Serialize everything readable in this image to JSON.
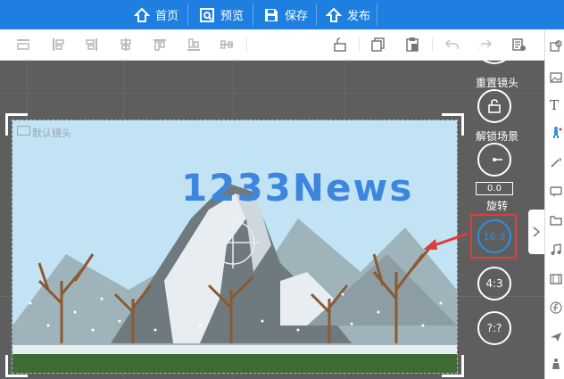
{
  "nav": {
    "home_label": "首页",
    "preview_label": "预览",
    "save_label": "保存",
    "publish_label": "发布"
  },
  "toolbar": {
    "icons": [
      "align-top-icon",
      "align-left-icon",
      "align-right-icon",
      "align-center-icon",
      "align-vcenter-icon",
      "align-bottom-icon",
      "distribute-icon",
      "unlock-icon",
      "copy-icon",
      "paste-icon",
      "undo-icon",
      "redo-icon",
      "layer-icon"
    ]
  },
  "scene": {
    "camera_label": "默认镜头",
    "title_text": "1233News"
  },
  "controls": {
    "reset_camera_label": "重置镜头",
    "unlock_scene_label": "解锁场景",
    "rotation_value": "0.0",
    "rotate_label": "旋转",
    "ratio_16_9": "16:9",
    "ratio_4_3": "4:3",
    "ratio_custom": "?:?"
  },
  "colors": {
    "topbar": "#1e7fe0",
    "highlight_box": "#e23b3b",
    "accent_blue": "#3d86de"
  }
}
